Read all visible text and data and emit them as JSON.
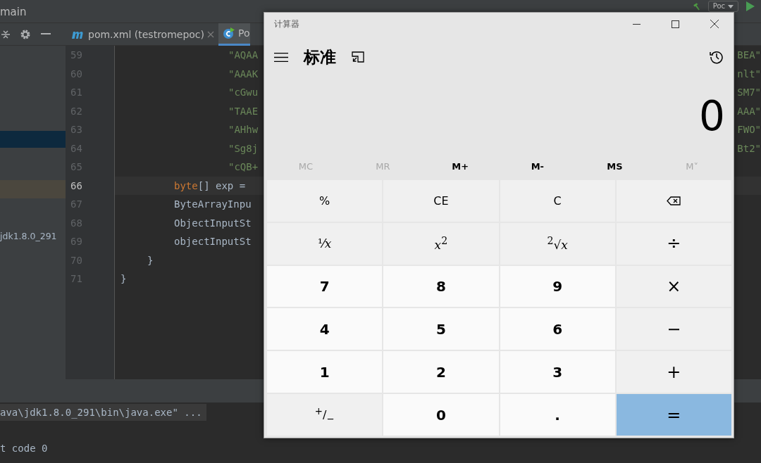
{
  "ide": {
    "branch": "main",
    "run_config": "Poc",
    "tabs": [
      {
        "label": "pom.xml (testromepoc)",
        "selected": false,
        "closable": true
      },
      {
        "label": "Po",
        "selected": true,
        "closable": false
      }
    ],
    "project_panel": {
      "items": [
        {
          "label": "jdk1.8.0_291"
        }
      ]
    },
    "editor": {
      "lines": [
        {
          "number": "59",
          "kind": "string",
          "code": "\"AQAA",
          "tail": "BEA\"",
          "current": false
        },
        {
          "number": "60",
          "kind": "string",
          "code": "\"AAAK",
          "tail": "nlt\"",
          "current": false
        },
        {
          "number": "61",
          "kind": "string",
          "code": "\"cGwu",
          "tail": "SM7\"",
          "current": false
        },
        {
          "number": "62",
          "kind": "string",
          "code": "\"TAAE",
          "tail": "AAA\"",
          "current": false
        },
        {
          "number": "63",
          "kind": "string",
          "code": "\"AHhw",
          "tail": "FWO\"",
          "current": false
        },
        {
          "number": "64",
          "kind": "string",
          "code": "\"Sg8j",
          "tail": "Bt2\"",
          "current": false
        },
        {
          "number": "65",
          "kind": "string",
          "code": "\"cQB+",
          "current": false
        },
        {
          "number": "66",
          "kind": "statement",
          "keyword": "byte",
          "code": "[] exp =",
          "current": true
        },
        {
          "number": "67",
          "kind": "statement",
          "code": "ByteArrayInpu",
          "current": false
        },
        {
          "number": "68",
          "kind": "statement",
          "code": "ObjectInputSt",
          "current": false
        },
        {
          "number": "69",
          "kind": "statement",
          "code": "objectInputSt",
          "current": false
        },
        {
          "number": "70",
          "kind": "method-close",
          "code": "}",
          "current": false
        },
        {
          "number": "71",
          "kind": "class-close",
          "code": "}",
          "current": false
        }
      ]
    },
    "console": {
      "lines": [
        {
          "text": "ava\\jdk1.8.0_291\\bin\\java.exe\" ...",
          "highlighted": true
        },
        {
          "text": "t code 0",
          "highlighted": false
        }
      ]
    }
  },
  "calculator": {
    "title": "计算器",
    "mode": "标准",
    "display": "0",
    "memory": [
      {
        "label": "MC",
        "disabled": true
      },
      {
        "label": "MR",
        "disabled": true
      },
      {
        "label": "M+",
        "disabled": false
      },
      {
        "label": "M-",
        "disabled": false
      },
      {
        "label": "MS",
        "disabled": false
      },
      {
        "label": "M˅",
        "disabled": true
      }
    ],
    "keys": [
      {
        "kind": "function",
        "label": "%"
      },
      {
        "kind": "function",
        "label": "CE"
      },
      {
        "kind": "function",
        "label": "C"
      },
      {
        "kind": "backspace"
      },
      {
        "kind": "math",
        "label": "¹⁄*x*"
      },
      {
        "kind": "math",
        "label": "*x*$^{2}$"
      },
      {
        "kind": "math",
        "label": "$^{2}$√*x*"
      },
      {
        "kind": "operator",
        "label": "÷"
      },
      {
        "kind": "digit",
        "label": "7"
      },
      {
        "kind": "digit",
        "label": "8"
      },
      {
        "kind": "digit",
        "label": "9"
      },
      {
        "kind": "operator",
        "label": "×"
      },
      {
        "kind": "digit",
        "label": "4"
      },
      {
        "kind": "digit",
        "label": "5"
      },
      {
        "kind": "digit",
        "label": "6"
      },
      {
        "kind": "operator",
        "label": "−"
      },
      {
        "kind": "digit",
        "label": "1"
      },
      {
        "kind": "digit",
        "label": "2"
      },
      {
        "kind": "digit",
        "label": "3"
      },
      {
        "kind": "operator",
        "label": "+"
      },
      {
        "kind": "function",
        "label": "$^{+}$/$_{−}$"
      },
      {
        "kind": "digit",
        "label": "0"
      },
      {
        "kind": "digit",
        "label": "."
      },
      {
        "kind": "equals",
        "label": "="
      }
    ]
  }
}
